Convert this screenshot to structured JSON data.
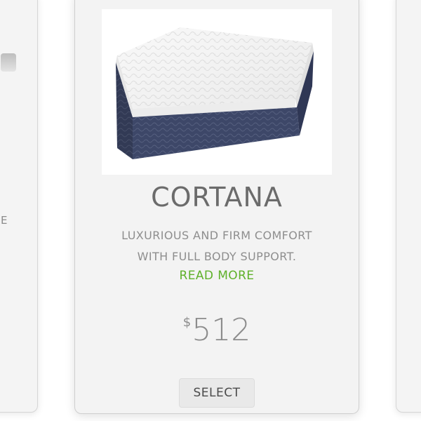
{
  "left_card": {
    "text_fragment": "E"
  },
  "product": {
    "name": "CORTANA",
    "description_line1": "LUXURIOUS AND FIRM COMFORT",
    "description_line2": "WITH FULL BODY SUPPORT.",
    "read_more_label": "READ MORE",
    "price_currency": "$",
    "price_amount": "512",
    "select_label": "SELECT",
    "image_icon": "mattress-image"
  },
  "colors": {
    "accent_green": "#5fb12a",
    "title_gray": "#6b6b6b",
    "card_bg": "#f3f3f3",
    "mattress_base": "#3f4a6b"
  }
}
